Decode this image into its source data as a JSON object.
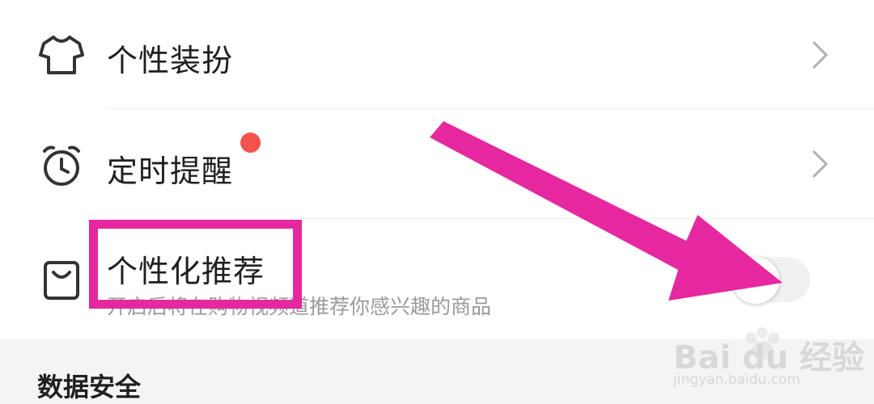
{
  "menu": {
    "items": [
      {
        "label": "个性装扮",
        "icon": "tshirt-icon",
        "accessory": "chevron-right-icon"
      },
      {
        "label": "定时提醒",
        "icon": "alarm-clock-icon",
        "accessory": "chevron-right-icon",
        "badge_color": "#f4524d"
      },
      {
        "label": "个性化推荐",
        "icon": "shopping-bag-icon",
        "subtitle": "开启后将在购物视频道推荐你感兴趣的商品",
        "toggle_on": false
      }
    ]
  },
  "section": {
    "title": "数据安全"
  },
  "annotation": {
    "color": "#e5289f"
  },
  "watermark": {
    "brand": "Bai du 经验",
    "url": "jingyan.baidu.com"
  }
}
